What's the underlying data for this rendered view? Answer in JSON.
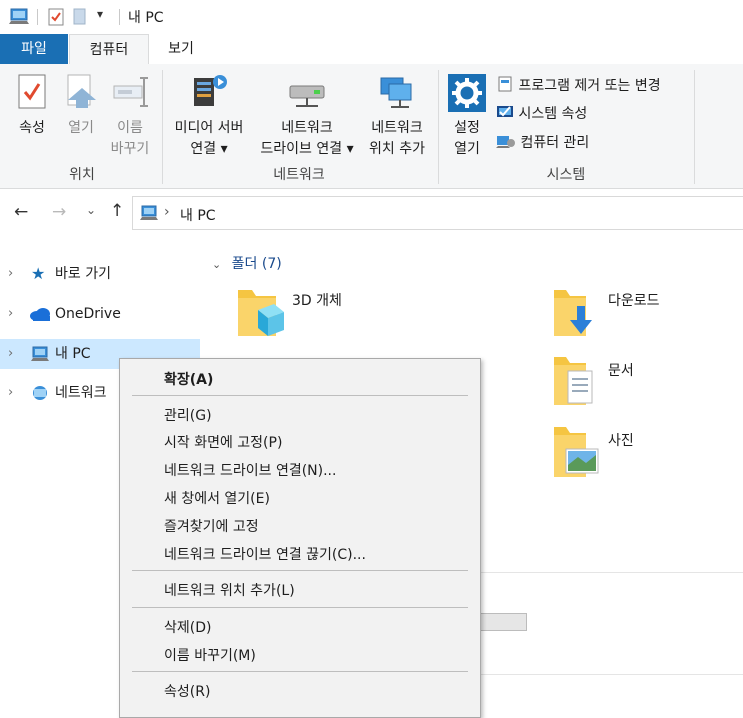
{
  "window": {
    "title": "내 PC"
  },
  "tabs": [
    {
      "label": "파일"
    },
    {
      "label": "컴퓨터"
    },
    {
      "label": "보기"
    }
  ],
  "ribbon": {
    "location_group": {
      "title": "위치",
      "properties": {
        "line1": "속성"
      },
      "open": {
        "line1": "열기"
      },
      "rename": {
        "line1": "이름",
        "line2": "바꾸기"
      }
    },
    "network_group": {
      "title": "네트워크",
      "media_server": {
        "line1": "미디어 서버",
        "line2": "연결 ▾"
      },
      "map_drive": {
        "line1": "네트워크",
        "line2": "드라이브 연결 ▾"
      },
      "add_location": {
        "line1": "네트워크",
        "line2": "위치 추가"
      }
    },
    "system_group": {
      "title": "시스템",
      "open_settings": {
        "line1": "설정",
        "line2": "열기"
      },
      "uninstall": "프로그램 제거 또는 변경",
      "system_properties": "시스템 속성",
      "manage": "컴퓨터 관리"
    }
  },
  "address": {
    "separator": "›",
    "path": "내 PC"
  },
  "nav_pane": {
    "items": [
      {
        "label": "바로 가기"
      },
      {
        "label": "OneDrive"
      },
      {
        "label": "내 PC"
      },
      {
        "label": "네트워크"
      }
    ]
  },
  "content": {
    "folders_header": "폴더 (7)",
    "folders": [
      {
        "label": "3D 개체"
      },
      {
        "label": "다운로드"
      },
      {
        "label": "문서"
      },
      {
        "label": "사진"
      }
    ]
  },
  "context_menu": {
    "items": [
      {
        "label": "확장(A)"
      },
      {
        "label": "관리(G)"
      },
      {
        "label": "시작 화면에 고정(P)"
      },
      {
        "label": "네트워크 드라이브 연결(N)..."
      },
      {
        "label": "새 창에서 열기(E)"
      },
      {
        "label": "즐겨찾기에 고정"
      },
      {
        "label": "네트워크 드라이브 연결 끊기(C)..."
      },
      {
        "label": "네트워크 위치 추가(L)"
      },
      {
        "label": "삭제(D)"
      },
      {
        "label": "이름 바꾸기(M)"
      },
      {
        "label": "속성(R)"
      }
    ]
  },
  "colors": {
    "accent": "#1a6fb4",
    "selection": "#cce8ff",
    "ribbon_bg": "#f5f6f7",
    "menu_bg": "#f2f2f2"
  }
}
